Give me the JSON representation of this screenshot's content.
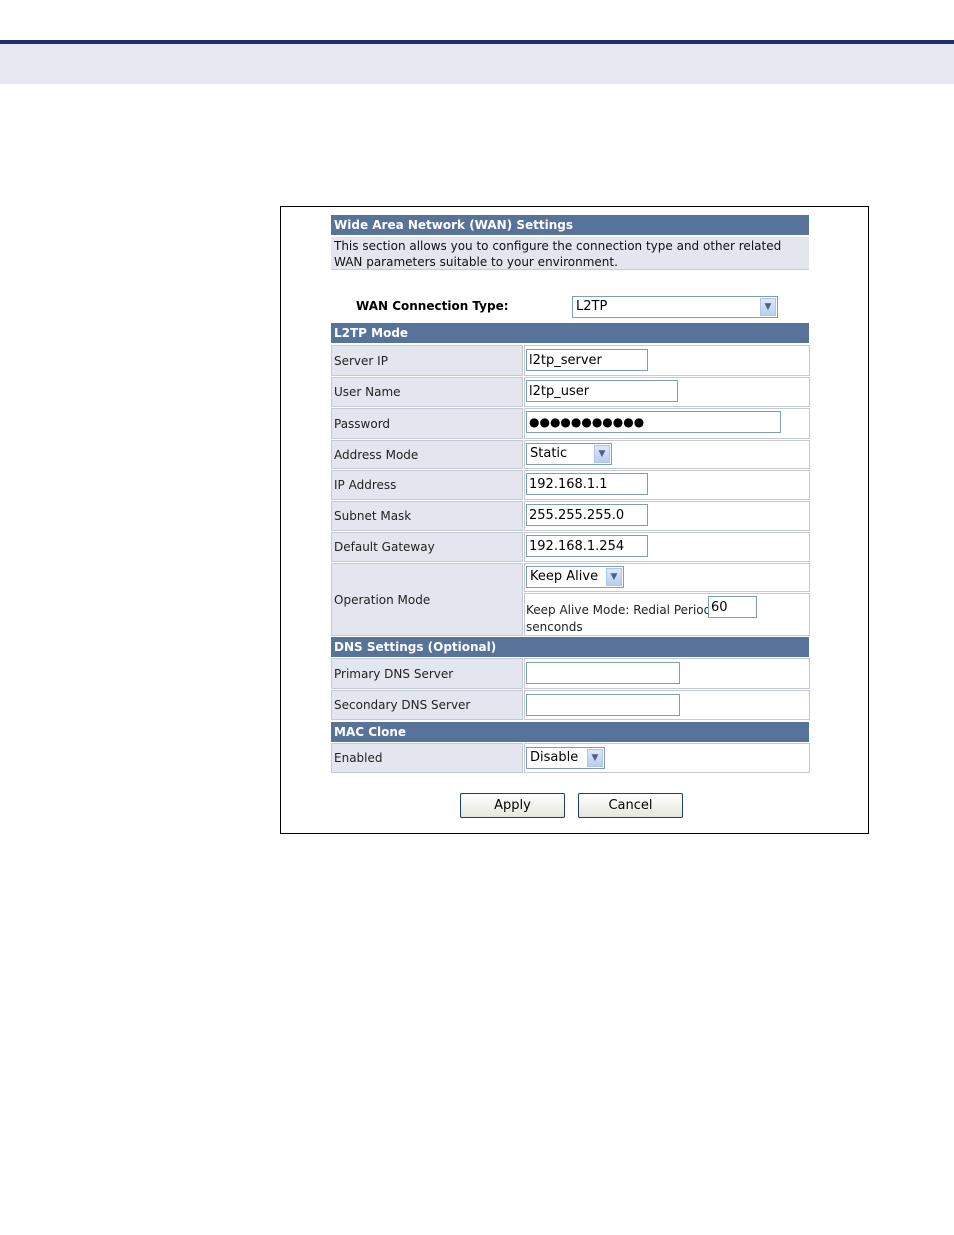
{
  "header": {},
  "wan": {
    "title": "Wide Area Network (WAN) Settings",
    "description": "This section allows you to configure the connection type and other related WAN parameters suitable to your environment.",
    "connection_type_label": "WAN Connection Type:",
    "connection_type_value": "L2TP"
  },
  "l2tp": {
    "section_title": "L2TP Mode",
    "server_ip_label": "Server IP",
    "server_ip_value": "l2tp_server",
    "user_name_label": "User Name",
    "user_name_value": "l2tp_user",
    "password_label": "Password",
    "password_value": "●●●●●●●●●●●",
    "address_mode_label": "Address Mode",
    "address_mode_value": "Static",
    "ip_address_label": "IP Address",
    "ip_address_value": "192.168.1.1",
    "subnet_mask_label": "Subnet Mask",
    "subnet_mask_value": "255.255.255.0",
    "default_gateway_label": "Default Gateway",
    "default_gateway_value": "192.168.1.254",
    "operation_mode_label": "Operation Mode",
    "operation_mode_value": "Keep Alive",
    "redial_label": "Keep Alive Mode: Redial Period",
    "redial_value": "60",
    "redial_unit": "senconds"
  },
  "dns": {
    "section_title": "DNS Settings (Optional)",
    "primary_label": "Primary DNS Server",
    "primary_value": "",
    "secondary_label": "Secondary DNS Server",
    "secondary_value": ""
  },
  "mac": {
    "section_title": "MAC Clone",
    "enabled_label": "Enabled",
    "enabled_value": "Disable"
  },
  "buttons": {
    "apply": "Apply",
    "cancel": "Cancel"
  },
  "colors": {
    "section_bar": "#58739a",
    "label_bg": "#e3e6ee",
    "top_rule": "#1d2f6f",
    "header_band": "#e6e8ef"
  }
}
